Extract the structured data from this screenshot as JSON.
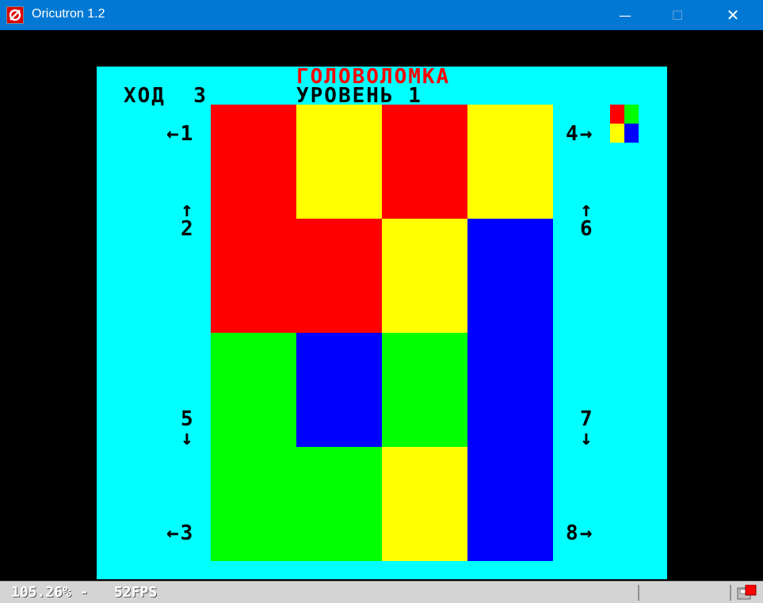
{
  "window": {
    "title": "Oricutron 1.2",
    "minimize_glyph": "—",
    "maximize_glyph": "☐",
    "close_glyph": "✕"
  },
  "game": {
    "title": "ГОЛОВОЛОМКА",
    "move_label": "ХОД  3",
    "level_label": "УРОВЕНЬ 1",
    "controls": {
      "c1": "←1",
      "c2_arrow": "↑",
      "c2_num": "2",
      "c3": "←3",
      "c4": "4→",
      "c5_num": "5",
      "c5_arrow": "↓",
      "c6_arrow": "↑",
      "c6_num": "6",
      "c7_num": "7",
      "c7_arrow": "↓",
      "c8": "8→"
    },
    "colors": {
      "red": "#ff0000",
      "yellow": "#ffff00",
      "green": "#00ff00",
      "blue": "#0000ff",
      "cyan": "#00ffff"
    },
    "grid": [
      [
        "red",
        "yellow",
        "red",
        "yellow"
      ],
      [
        "red",
        "red",
        "yellow",
        "blue"
      ],
      [
        "green",
        "blue",
        "green",
        "blue"
      ],
      [
        "green",
        "green",
        "yellow",
        "blue"
      ]
    ],
    "target_pattern": [
      [
        "red",
        "green"
      ],
      [
        "yellow",
        "blue"
      ]
    ]
  },
  "status": {
    "text": "105.26% -   52FPS"
  }
}
